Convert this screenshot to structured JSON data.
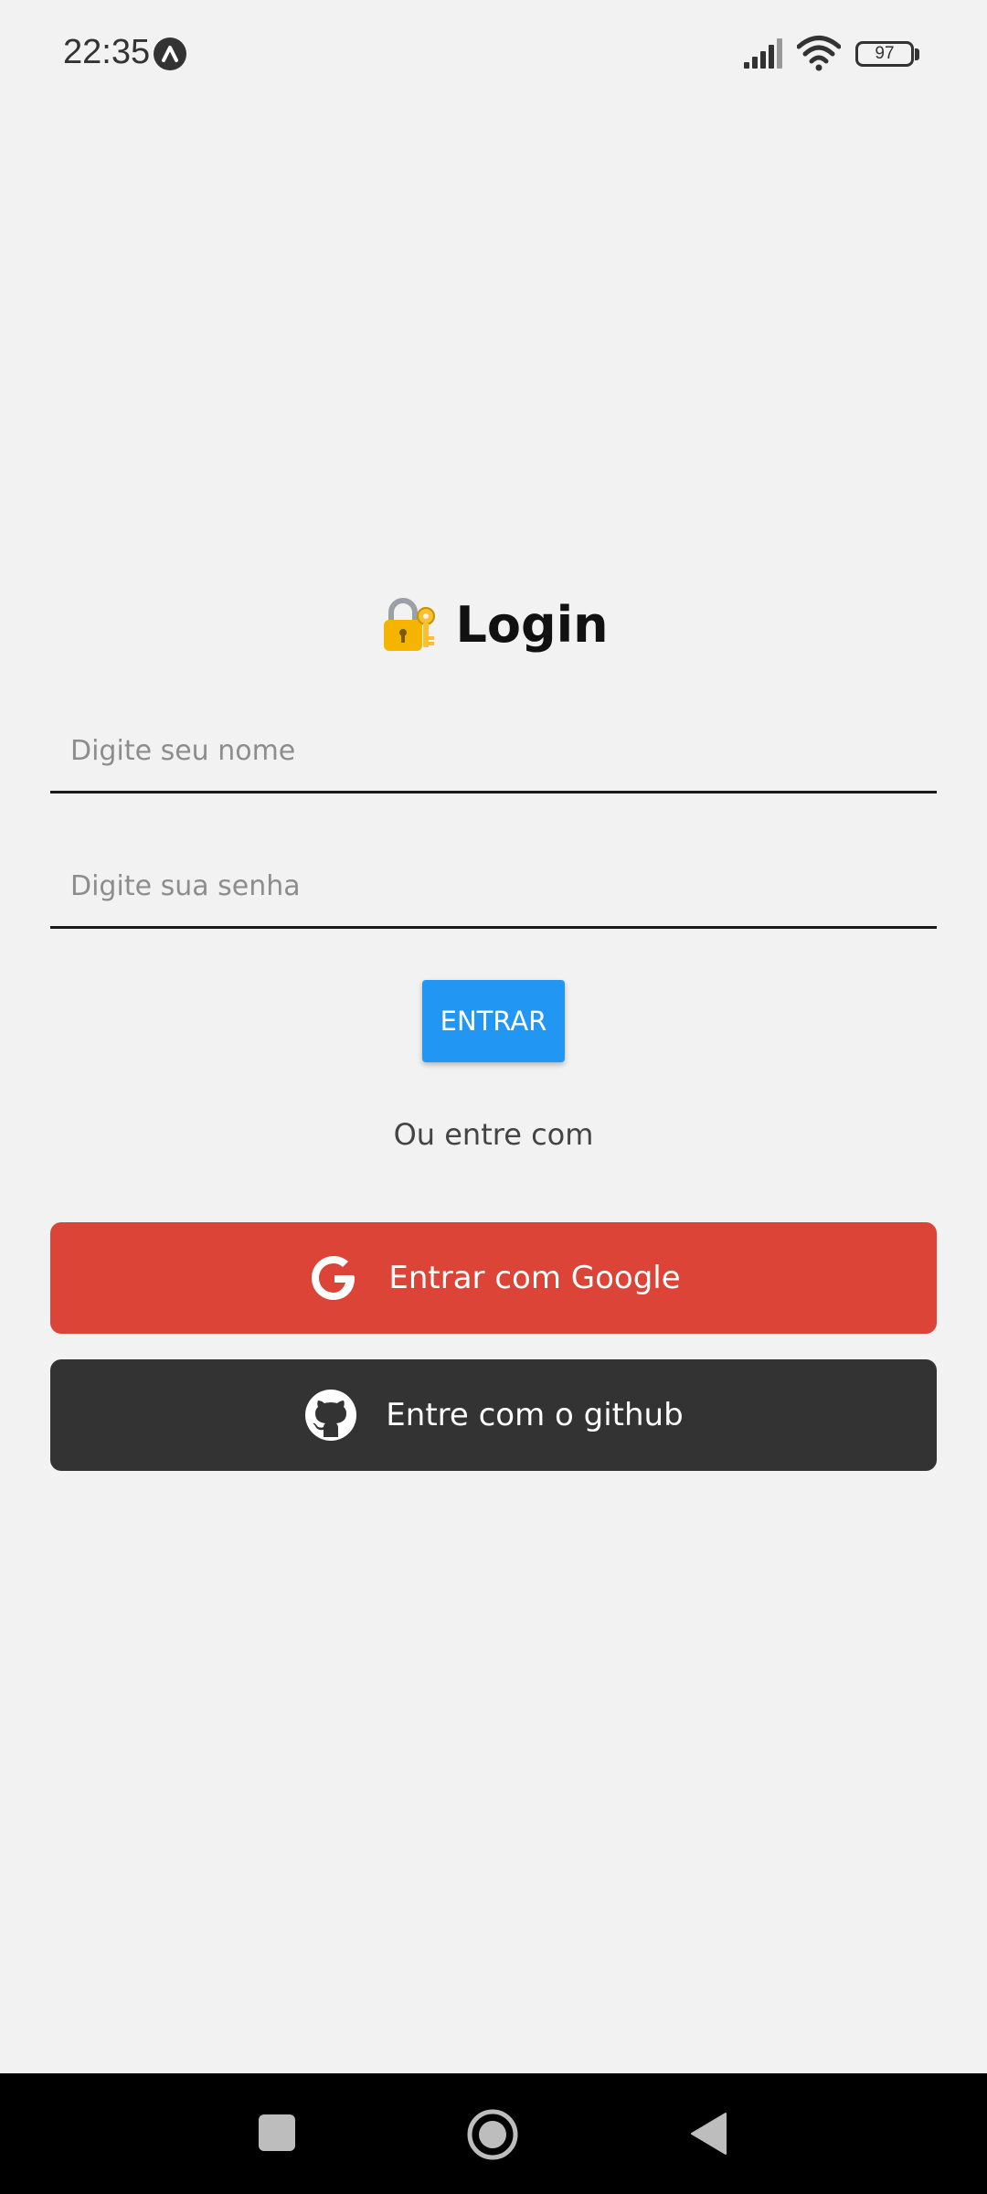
{
  "status_bar": {
    "time": "22:35",
    "battery": "97",
    "icons": [
      "a-badge-icon",
      "signal-icon",
      "wifi-icon",
      "battery-icon"
    ]
  },
  "title": {
    "icon": "lock-with-key-icon",
    "text": "Login"
  },
  "form": {
    "name_placeholder": "Digite seu nome",
    "name_value": "",
    "password_placeholder": "Digite sua senha",
    "password_value": "",
    "submit_label": "ENTRAR"
  },
  "divider_text": "Ou entre com",
  "social": {
    "google_label": "Entrar com Google",
    "github_label": "Entre com o github"
  },
  "nav_bar": {
    "icons": [
      "recents-square-icon",
      "home-circle-icon",
      "back-triangle-icon"
    ]
  },
  "colors": {
    "background": "#f2f2f2",
    "primary": "#2196f3",
    "google": "#db4437",
    "github": "#333333"
  }
}
